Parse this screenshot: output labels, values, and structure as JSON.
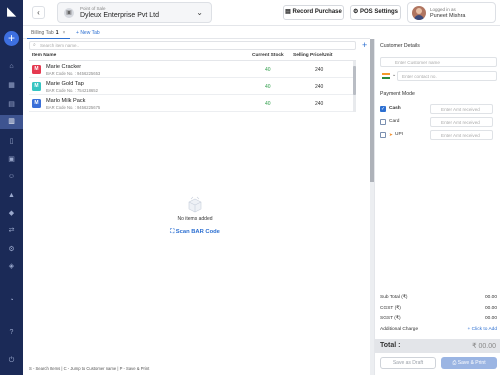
{
  "sidebar": {
    "logo_icon": "app-logo-icon",
    "icons": [
      "home-icon",
      "grid-icon",
      "cart-icon",
      "billing-icon",
      "receipt-icon",
      "box-icon",
      "people-icon",
      "chart-icon",
      "tag-icon",
      "transfer-icon",
      "settings-icon",
      "gift-icon",
      "pie-icon",
      "help-icon",
      "power-icon"
    ]
  },
  "header": {
    "back_label": "‹",
    "pos_label": "Point of Sale",
    "pos_value": "Dyleux Enterprise Pvt Ltd",
    "record_purchase_label": "Record Purchase",
    "pos_settings_label": "POS Settings",
    "logged_in_label": "Logged in as",
    "user_name": "Puneet Mishra"
  },
  "tabs": {
    "billing_tab_label": "Billing Tab",
    "billing_tab_count": "1",
    "close_label": "×",
    "new_tab_label": "New Tab"
  },
  "search": {
    "placeholder": "Search item name.."
  },
  "table": {
    "headers": {
      "item": "Item Name",
      "stock": "Current Stock",
      "price": "Selling Price/Unit"
    },
    "rows": [
      {
        "badge": "M",
        "badge_color": "#e53950",
        "name": "Marie Cracker",
        "code": "BAR Code No. : 9456225653",
        "stock": "40",
        "price": "240"
      },
      {
        "badge": "M",
        "badge_color": "#36c5c2",
        "name": "Marie Gold Tap",
        "code": "BAR Code No. : 754218652",
        "stock": "40",
        "price": "240"
      },
      {
        "badge": "M",
        "badge_color": "#3a6fd8",
        "name": "Marlo Milk Pack",
        "code": "BAR Code No. : 9456225675",
        "stock": "40",
        "price": "240"
      }
    ]
  },
  "empty_state": {
    "text": "No items added",
    "scan_label": "Scan BAR Code"
  },
  "shortcuts": "S - Search Items  |  C - Jump to Customer name  |  P - Save & Print",
  "customer": {
    "title": "Customer Details",
    "name_placeholder": "Enter Customer name",
    "contact_placeholder": "Enter contact no."
  },
  "payment": {
    "title": "Payment Mode",
    "amount_placeholder": "Enter Amt received",
    "modes": [
      {
        "label": "Cash",
        "checked": true
      },
      {
        "label": "Card",
        "checked": false
      },
      {
        "label": "UPI",
        "checked": false
      }
    ]
  },
  "summary": {
    "subtotal_label": "Sub Total (₹)",
    "subtotal_value": "00.00",
    "cgst_label": "CGST (₹)",
    "cgst_value": "00.00",
    "sgst_label": "SGST (₹)",
    "sgst_value": "00.00",
    "additional_label": "Additional Charge",
    "additional_link": "Click to Add",
    "total_label": "Total :",
    "total_value": "₹ 00.00"
  },
  "actions": {
    "draft_label": "Save as Draft",
    "print_label": "Save & Print"
  },
  "colors": {
    "sidebar": "#1b2a57",
    "accent": "#2c6fd1",
    "stock_green": "#2e9d49"
  }
}
